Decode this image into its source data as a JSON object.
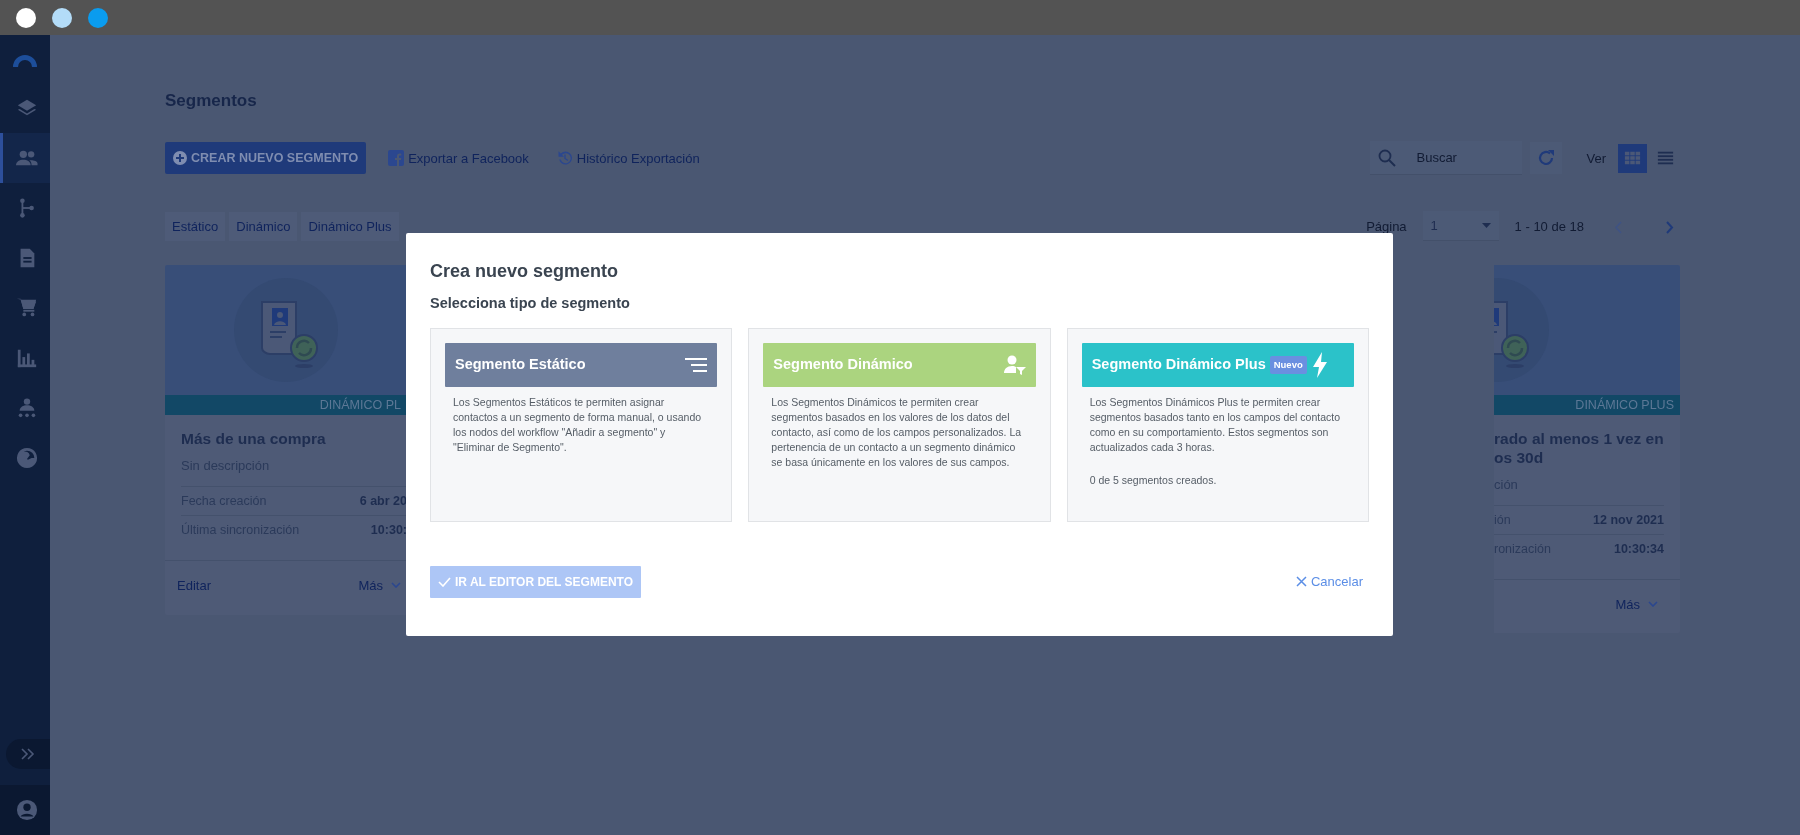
{
  "window": {
    "buttons": [
      {
        "color": "#ffffff"
      },
      {
        "color": "#b3dcf8"
      },
      {
        "color": "#0a9cef"
      }
    ]
  },
  "sidebar": {
    "items": [
      {
        "kind": "layers",
        "selected": false
      },
      {
        "kind": "contacts",
        "selected": true
      },
      {
        "kind": "flow",
        "selected": false
      },
      {
        "kind": "document",
        "selected": false
      },
      {
        "kind": "cart",
        "selected": false
      },
      {
        "kind": "chart",
        "selected": false
      },
      {
        "kind": "hierarchy",
        "selected": false
      },
      {
        "kind": "gauge",
        "selected": false
      }
    ],
    "bottom": [
      {
        "kind": "expand"
      },
      {
        "kind": "user"
      }
    ]
  },
  "page": {
    "title": "Segmentos",
    "create_button": "CREAR NUEVO SEGMENTO",
    "links": [
      {
        "kind": "facebook",
        "label": "Exportar a Facebook"
      },
      {
        "kind": "history",
        "label": "Histórico Exportación"
      }
    ],
    "search": {
      "placeholder": "Buscar"
    },
    "view": {
      "label": "Ver",
      "options": [
        {
          "kind": "grid",
          "selected": true
        },
        {
          "kind": "list",
          "selected": false
        }
      ]
    },
    "tabs": [
      {
        "label": "Estático",
        "selected": false
      },
      {
        "label": "Dinámico",
        "selected": false
      },
      {
        "label": "Dinámico Plus",
        "selected": false
      }
    ],
    "pagination": {
      "label": "Página",
      "page": "1",
      "range": "1 - 10 de 18"
    },
    "cards": [
      {
        "type_label": "DINÁMICO PL",
        "title_lines": [
          "Más de una compra"
        ],
        "description": "Sin descripción",
        "fields": [
          {
            "label": "Fecha creación",
            "value": "6 abr 20"
          },
          {
            "label": "Última sincronización",
            "value": "10:30:"
          }
        ],
        "actions": [
          {
            "kind": "edit",
            "label": "Editar"
          },
          {
            "kind": "more",
            "label": "Más"
          }
        ]
      },
      {
        "type_label": "DINÁMICO PLUS",
        "title_lines": [
          "rado al menos 1 vez en",
          "os 30d"
        ],
        "description": "ción",
        "fields": [
          {
            "label": "ión",
            "value": "12 nov 2021"
          },
          {
            "label": "ronización",
            "value": "10:30:34"
          }
        ],
        "actions": [
          {
            "kind": "more",
            "label": "Más"
          }
        ]
      }
    ]
  },
  "modal": {
    "title": "Crea nuevo segmento",
    "subtitle": "Selecciona tipo de segmento",
    "options": [
      {
        "kind": "static",
        "name": "Segmento Estático",
        "color": "#6f7f9d",
        "selected": false,
        "description": "Los Segmentos Estáticos te permiten asignar contactos a un segmento de forma manual, o usando los nodos del workflow \"Añadir a segmento\" y \"Eliminar de Segmento\"."
      },
      {
        "kind": "dynamic",
        "name": "Segmento Dinámico",
        "color": "#abd47f",
        "selected": false,
        "description": "Los Segmentos Dinámicos te permiten crear segmentos basados en los valores de los datos del contacto, así como de los campos personalizados. La pertenencia de un contacto a un segmento dinámico se basa únicamente en los valores de sus campos."
      },
      {
        "kind": "plus",
        "name": "Segmento Dinámico Plus",
        "badge": "Nuevo",
        "color": "#2bc2c9",
        "selected": false,
        "description": "Los Segmentos Dinámicos Plus te permiten crear segmentos basados tanto en los campos del contacto como en su comportamiento. Estos segmentos son actualizados cada 3 horas.",
        "note": "0 de 5 segmentos creados."
      }
    ],
    "confirm": {
      "label": "IR AL EDITOR DEL SEGMENTO",
      "disabled": true
    },
    "cancel": {
      "label": "Cancelar"
    }
  }
}
